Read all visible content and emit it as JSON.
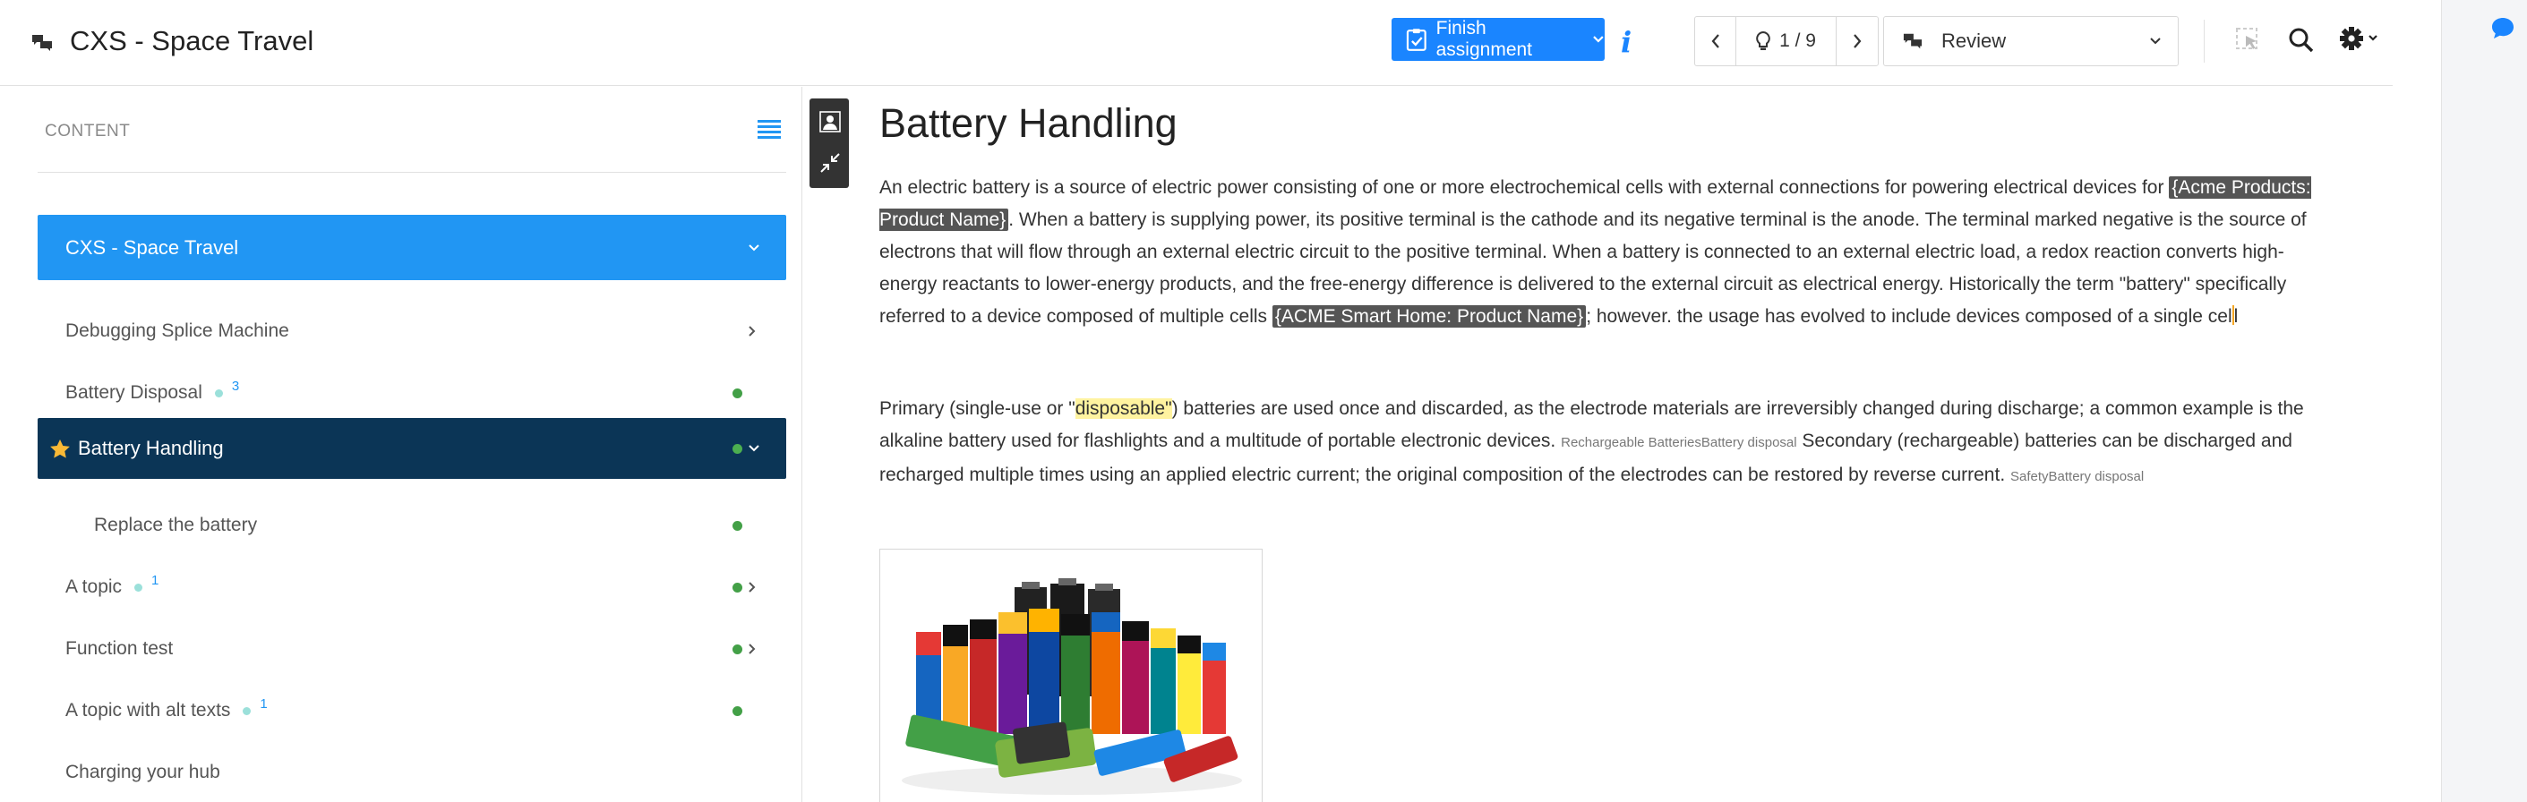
{
  "header": {
    "app_title": "CXS - Space Travel",
    "finish_label": "Finish assignment",
    "nav_counter": "1 / 9",
    "review_label": "Review",
    "accent_color": "#1a85ff"
  },
  "sidebar": {
    "content_label": "CONTENT",
    "root": {
      "label": "CXS - Space Travel"
    },
    "items": [
      {
        "label": "Debugging Splice Machine"
      },
      {
        "label": "Battery Disposal",
        "count": "3"
      },
      {
        "label": "Battery Handling"
      },
      {
        "label": "Replace the battery"
      },
      {
        "label": "A topic",
        "count": "1"
      },
      {
        "label": "Function test"
      },
      {
        "label": "A topic with alt texts",
        "count": "1"
      },
      {
        "label": "Charging your hub"
      }
    ],
    "active_color": "#0b3556",
    "root_color": "#2196f3",
    "status_color": "#43a047"
  },
  "article": {
    "title": "Battery Handling",
    "p1_a": "An electric battery is a source of electric power consisting of one or more electrochemical cells with external connections for powering electrical devices for ",
    "p1_var1": "{Acme Products: Product Name}",
    "p1_b": ". When a battery is supplying power, its positive terminal is the cathode and its negative terminal is the anode. The terminal marked negative is the source of electrons that will flow through an external electric circuit to the positive terminal. When a battery is connected to an external electric load, a redox reaction converts high-energy reactants to lower-energy products, and the free-energy difference is delivered to the external circuit as electrical energy. Historically the term \"battery\" specifically referred to a device composed of multiple cells ",
    "p1_var2": "{ACME Smart Home: Product Name}",
    "p1_c": "; however. the usage has evolved to include devices composed of a single cel",
    "p1_d": "l",
    "p2_a": "Primary (single-use or \"",
    "p2_hl": "disposable\"",
    "p2_b": ") batteries are used once and discarded, as the electrode materials are irreversibly changed during discharge; a common example is the alkaline battery used for flashlights and a multitude of portable electronic devices.  ",
    "p2_tag1": "Rechargeable BatteriesBattery disposal",
    "p2_c": " Secondary (rechargeable) batteries can be discharged and recharged multiple times using an applied electric current; the original composition of the electrodes can be restored by reverse current.  ",
    "p2_tag2": "SafetyBattery disposal"
  }
}
